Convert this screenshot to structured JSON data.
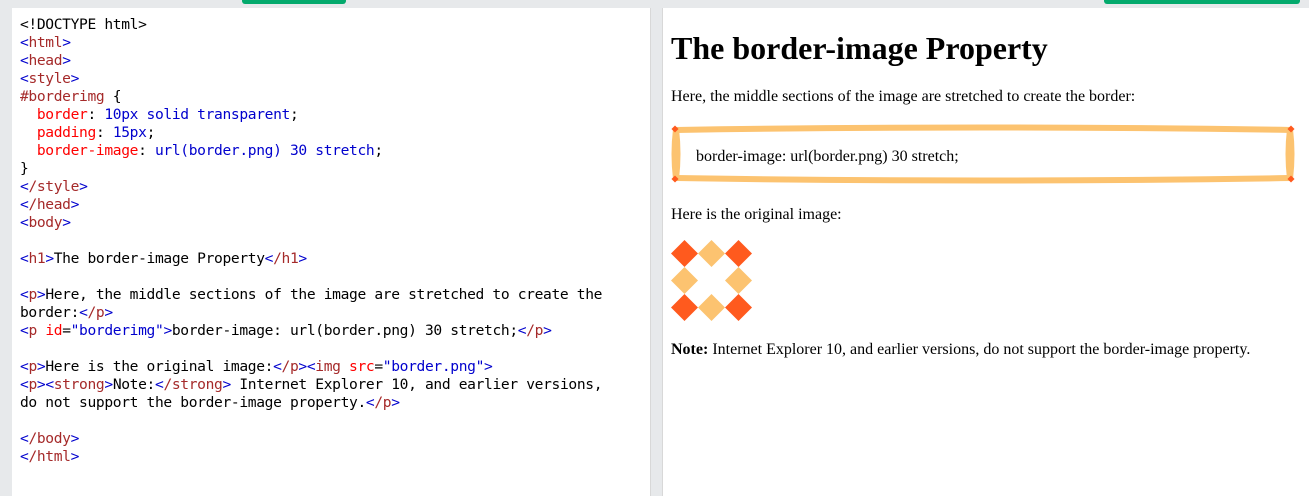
{
  "colors": {
    "accent": "#04aa6d",
    "diamond_dark": "#ff5a1e",
    "diamond_light": "#fcc370"
  },
  "code": {
    "l1": "<!DOCTYPE html>",
    "html_open": "html",
    "head_open": "head",
    "style_open": "style",
    "selector": "#borderimg",
    "brace_open": " {",
    "p1_name": "border",
    "p1_value": "10px solid transparent",
    "p2_name": "padding",
    "p2_value": "15px",
    "p3_name": "border-image",
    "p3_value": "url(border.png) 30 stretch",
    "brace_close": "}",
    "style_close": "/style",
    "head_close": "/head",
    "body_open": "body",
    "h1_tag": "h1",
    "h1_text": "The border-image Property",
    "h1_close": "/h1",
    "p_tag": "p",
    "p_text_1": "Here, the middle sections of the image are stretched to create the",
    "p_text_2": "border:",
    "p_close": "/p",
    "id_attr": "id",
    "id_value": "\"borderimg\"",
    "p2_text": "border-image: url(border.png) 30 stretch;",
    "p3_text": "Here is the original image:",
    "img_tag": "img",
    "src_attr": "src",
    "src_value": "\"border.png\"",
    "strong_tag": "strong",
    "note_label": "Note:",
    "strong_close": "/strong",
    "note_text_1": " Internet Explorer 10, and earlier versions,",
    "note_text_2": "do not support the border-image property.",
    "body_close": "/body",
    "html_close": "/html"
  },
  "result": {
    "heading": "The border-image Property",
    "intro": "Here, the middle sections of the image are stretched to create the border:",
    "bordered_text": "border-image: url(border.png) 30 stretch;",
    "original_label": "Here is the original image:",
    "note_label": "Note:",
    "note_text": " Internet Explorer 10, and earlier versions, do not support the border-image property."
  }
}
